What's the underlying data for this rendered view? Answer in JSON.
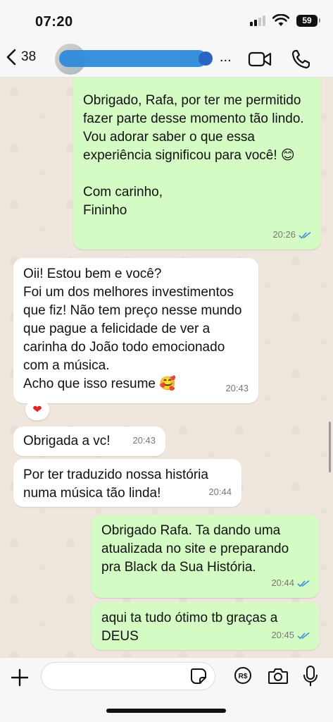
{
  "status": {
    "time": "07:20",
    "battery": "59"
  },
  "header": {
    "unread_count": "38",
    "name_ellipsis": "..."
  },
  "messages": [
    {
      "direction": "out",
      "text": "Obrigado, Rafa, por ter me permitido fazer parte desse momento tão lindo. Vou adorar saber o que essa experiência significou para você! 😊\n\nCom carinho,\nFininho",
      "time": "20:26",
      "status": "read"
    },
    {
      "direction": "in",
      "text": "Oii! Estou bem e você?\nFoi um dos melhores investimentos que fiz! Não tem preço nesse mundo que pague a felicidade de ver a carinha do João todo emocionado com a música.\nAcho que isso resume 🥰",
      "time": "20:43",
      "reaction": "❤"
    },
    {
      "direction": "in",
      "text": "Obrigada a vc!",
      "time": "20:43"
    },
    {
      "direction": "in",
      "text": "Por ter traduzido nossa história numa música tão linda!",
      "time": "20:44"
    },
    {
      "direction": "out",
      "text": "Obrigado Rafa. Ta dando uma atualizada no site e preparando pra Black da Sua História.",
      "time": "20:44",
      "status": "read"
    },
    {
      "direction": "out",
      "text": "aqui ta tudo ótimo tb graças a DEUS",
      "time": "20:45",
      "status": "read"
    }
  ],
  "input": {
    "placeholder": ""
  },
  "icons": {
    "back": "chevron-left-icon",
    "video": "video-camera-icon",
    "call": "phone-icon",
    "plus": "plus-icon",
    "sticker": "sticker-icon",
    "pix": "currency-icon",
    "camera": "camera-icon",
    "mic": "microphone-icon"
  },
  "colors": {
    "outgoing_bubble": "#d4fbc4",
    "incoming_bubble": "#ffffff",
    "read_ticks": "#3b8de0"
  }
}
